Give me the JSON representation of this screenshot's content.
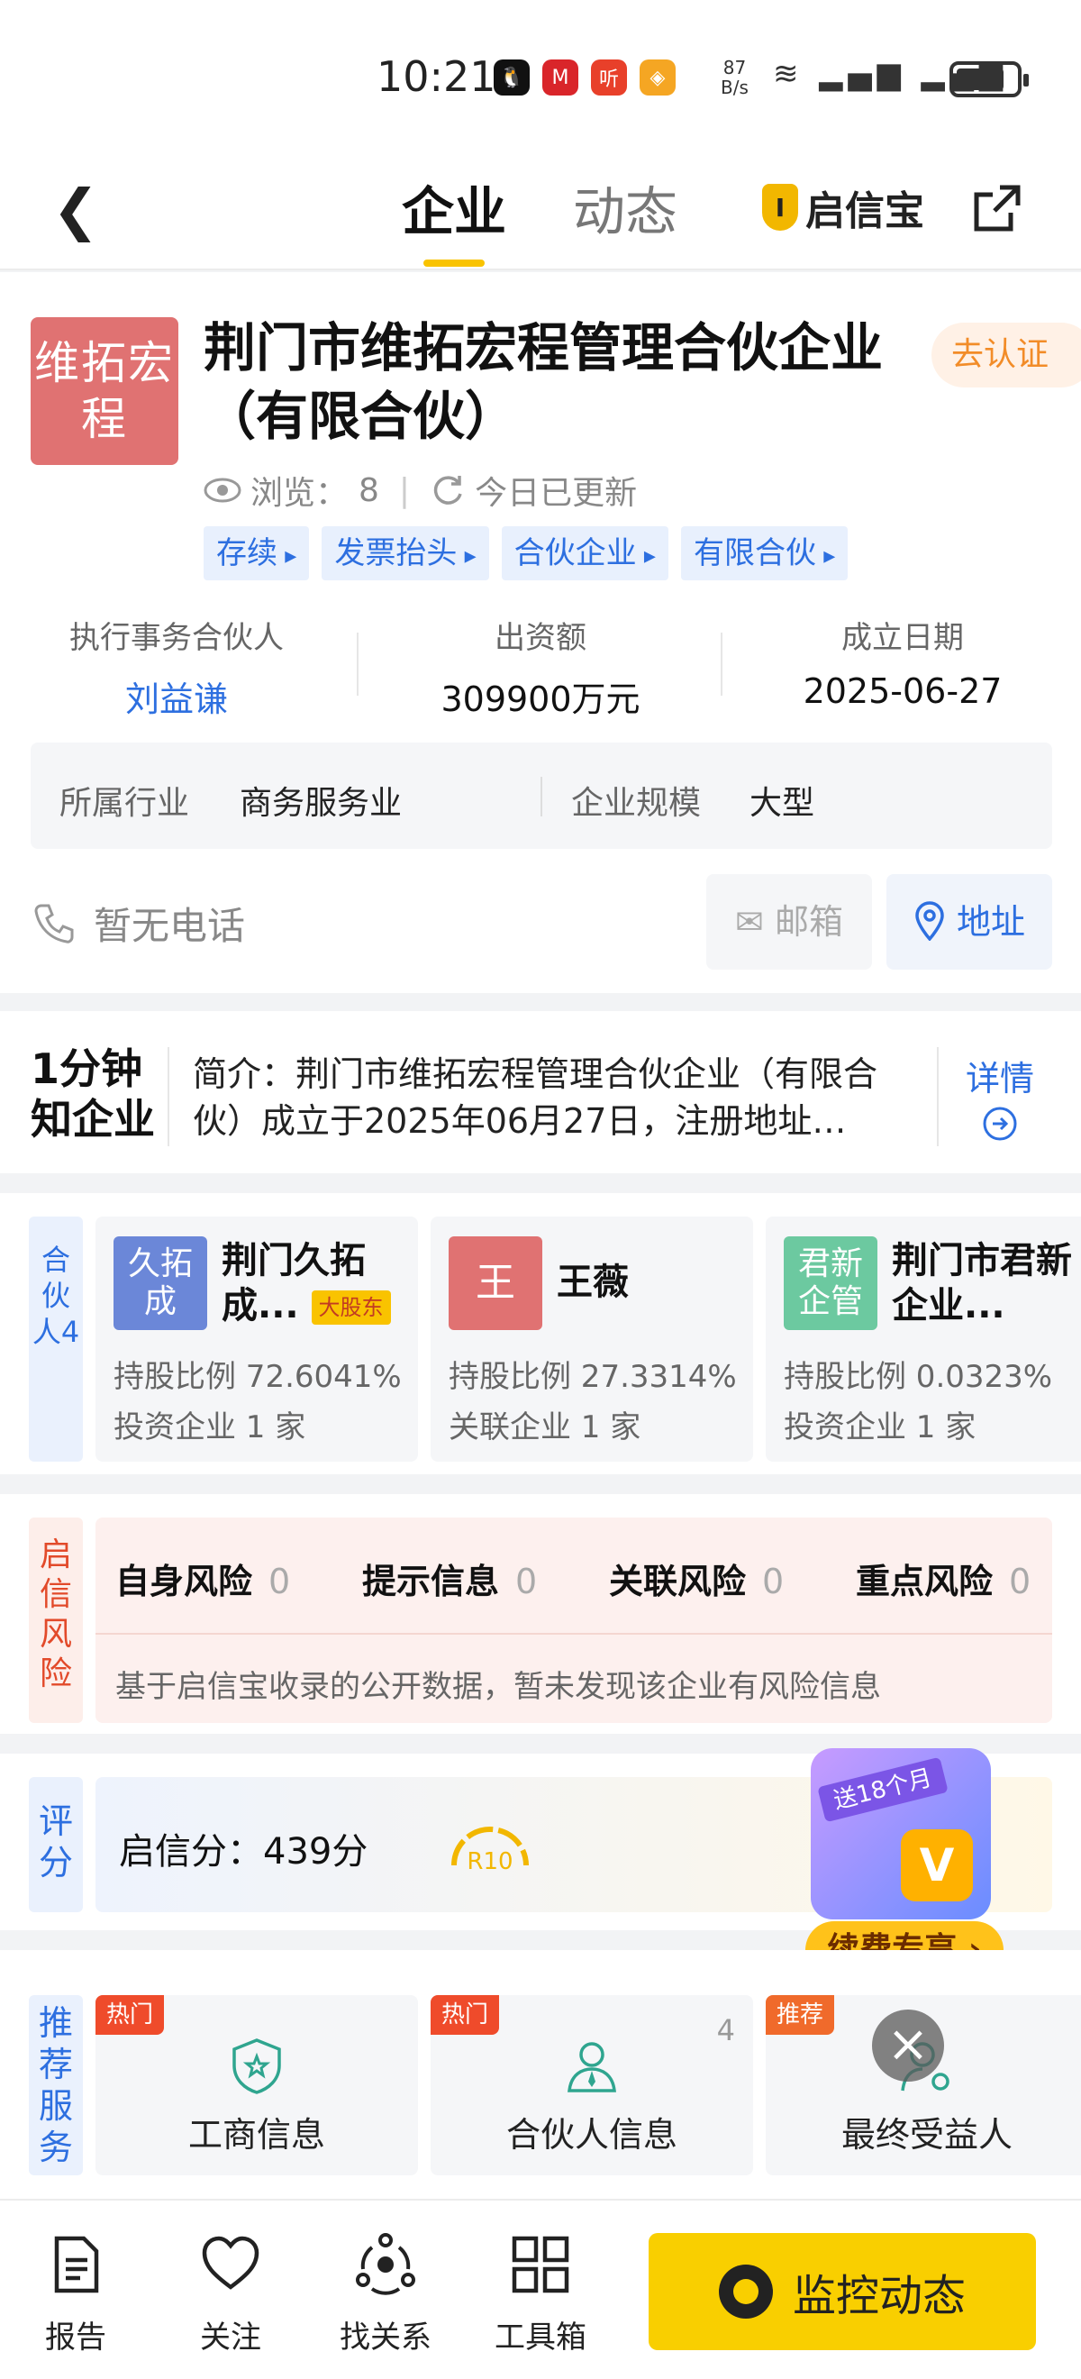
{
  "status": {
    "time": "10:21",
    "net_speed_value": "87",
    "net_speed_unit": "B/s",
    "signal": "4G 5G"
  },
  "nav": {
    "tab_active": "企业",
    "tab_inactive": "动态",
    "brand": "启信宝"
  },
  "company": {
    "logo_text": "维拓宏程",
    "name": "荆门市维拓宏程管理合伙企业（有限合伙）",
    "verify": "去认证",
    "views_label": "浏览：",
    "views": "8",
    "updated": "今日已更新",
    "tags": [
      "存续",
      "发票抬头",
      "合伙企业",
      "有限合伙"
    ],
    "partner_label": "执行事务合伙人",
    "partner": "刘益谦",
    "capital_label": "出资额",
    "capital": "309900万元",
    "date_label": "成立日期",
    "date": "2025-06-27",
    "industry_label": "所属行业",
    "industry": "商务服务业",
    "scale_label": "企业规模",
    "scale": "大型",
    "phone": "暂无电话",
    "email_btn": "邮箱",
    "address_btn": "地址"
  },
  "intro": {
    "badge_line1": "1分钟",
    "badge_line2": "知企业",
    "text": "简介：荆门市维拓宏程管理合伙企业（有限合伙）成立于2025年06月27日，注册地址…",
    "more": "详情"
  },
  "partners": {
    "side": "合伙人4",
    "items": [
      {
        "avatar": "久拓成",
        "name": "荆门久拓成...",
        "badge": "大股东",
        "line1": "持股比例 72.6041%",
        "line2": "投资企业 1 家",
        "color": "#6b87d8"
      },
      {
        "avatar": "王",
        "name": "王薇",
        "badge": "",
        "line1": "持股比例 27.3314%",
        "line2": "关联企业 1 家",
        "color": "#e07272"
      },
      {
        "avatar": "君新企管",
        "name": "荆门市君新企业...",
        "badge": "",
        "line1": "持股比例 0.0323%",
        "line2": "投资企业 1 家",
        "color": "#6cc9a0"
      }
    ]
  },
  "risk": {
    "side": "启信风险",
    "items": [
      {
        "label": "自身风险",
        "count": "0"
      },
      {
        "label": "提示信息",
        "count": "0"
      },
      {
        "label": "关联风险",
        "count": "0"
      },
      {
        "label": "重点风险",
        "count": "0"
      }
    ],
    "note": "基于启信宝收录的公开数据，暂未发现该企业有风险信息"
  },
  "score": {
    "side": "评分",
    "text": "启信分：439分",
    "grade": "R10"
  },
  "promo": {
    "ribbon": "送18个月",
    "button": "续费专享"
  },
  "services": {
    "side": "推荐服务",
    "items": [
      {
        "tag": "热门",
        "label": "工商信息",
        "count": ""
      },
      {
        "tag": "热门",
        "label": "合伙人信息",
        "count": "4"
      },
      {
        "tag": "推荐",
        "label": "最终受益人",
        "count": ""
      }
    ]
  },
  "bottom": {
    "report": "报告",
    "follow": "关注",
    "relations": "找关系",
    "toolbox": "工具箱",
    "monitor": "监控动态"
  }
}
